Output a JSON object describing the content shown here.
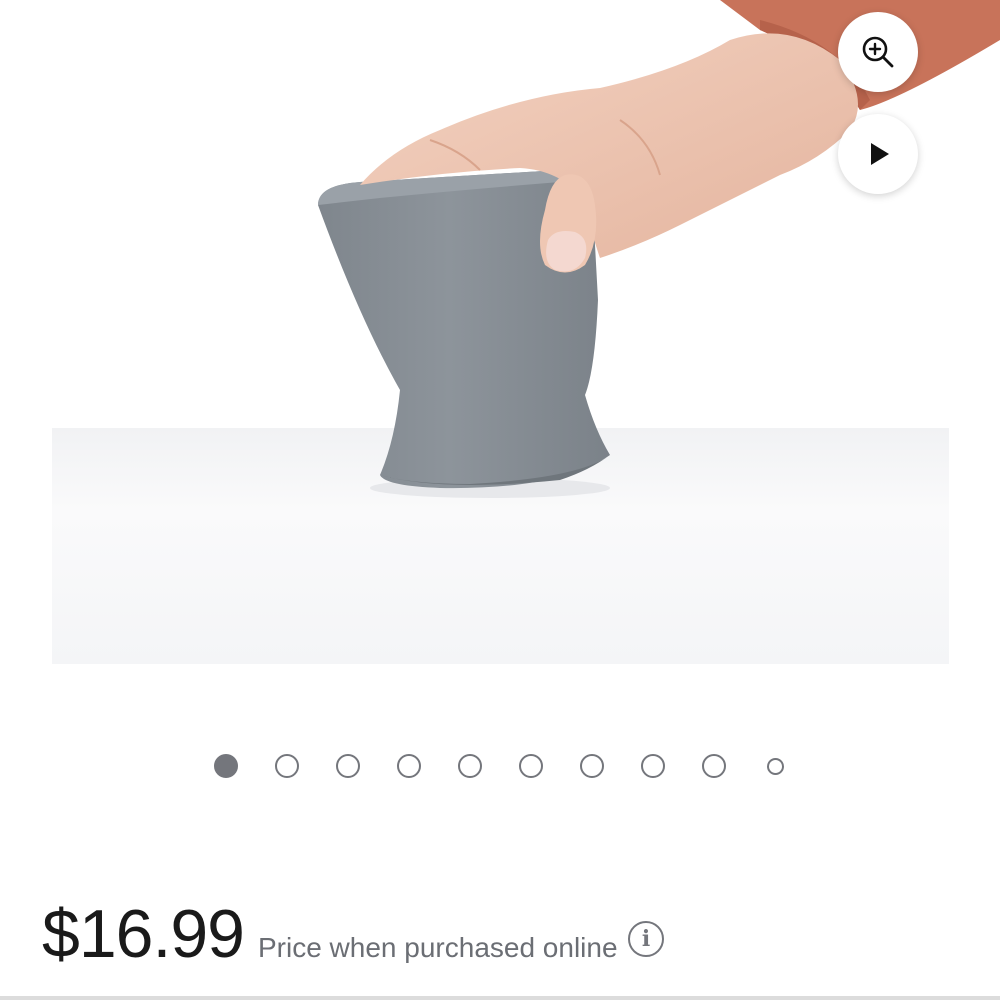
{
  "product": {
    "image_alt": "Gray silicone cup being held by a hand, tilted on a white surface",
    "image_count": 10,
    "active_image_index": 0
  },
  "controls": {
    "zoom_icon": "zoom-in-icon",
    "play_icon": "play-icon"
  },
  "price": {
    "amount": "$16.99",
    "note": "Price when purchased online",
    "info_label": "i"
  },
  "colors": {
    "dot": "#74767c",
    "cup": "#8a9198",
    "price_text": "#1a1a1a"
  }
}
